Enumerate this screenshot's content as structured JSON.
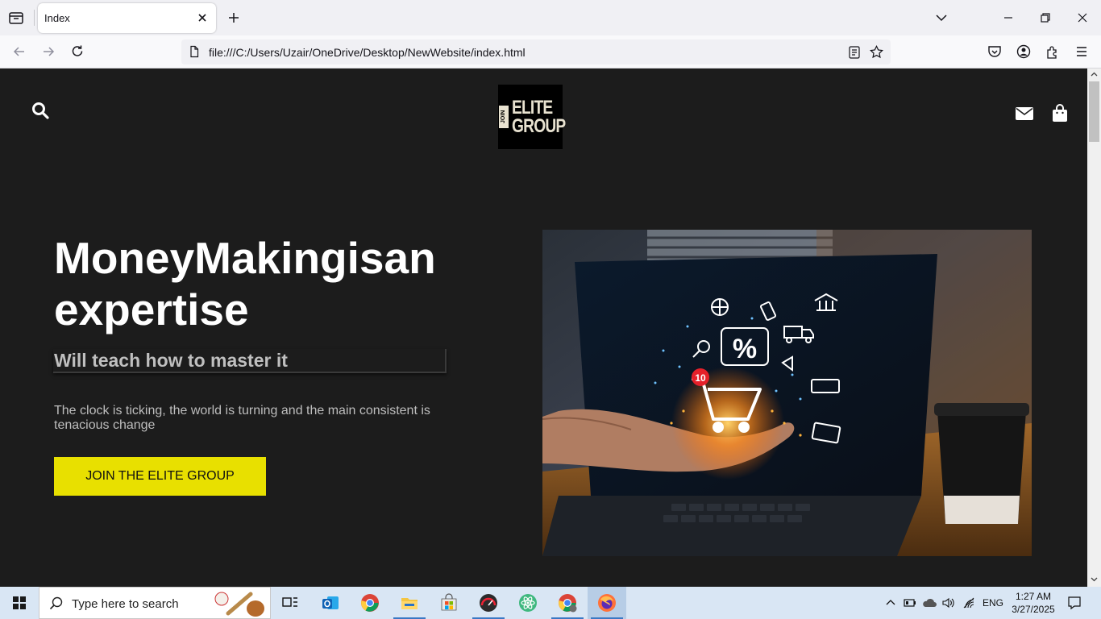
{
  "browser": {
    "tab": {
      "title": "Index"
    },
    "url": "file:///C:/Users/Uzair/OneDrive/Desktop/NewWebsite/index.html"
  },
  "site": {
    "logo": {
      "tag": "JOIN",
      "line1": "ELITE",
      "line2": "GROUP"
    },
    "hero": {
      "title": "MoneyMakingisan expertise",
      "subtitle": "Will teach how to master it",
      "description": "The clock is ticking, the world is turning and the main consistent is tenacious change",
      "cta_label": "JOIN THE ELITE GROUP"
    },
    "colors": {
      "background": "#1c1c1c",
      "cta": "#e8e000",
      "title": "#ffffff"
    }
  },
  "hero_image": {
    "badge": "10",
    "percent": "%"
  },
  "taskbar": {
    "search_placeholder": "Type here to search",
    "apps": [
      "task-view",
      "outlook",
      "chrome",
      "file-explorer",
      "microsoft-store",
      "wpm",
      "atom",
      "chrome-profile",
      "firefox"
    ],
    "language": "ENG",
    "time": "1:27 AM",
    "date": "3/27/2025"
  }
}
